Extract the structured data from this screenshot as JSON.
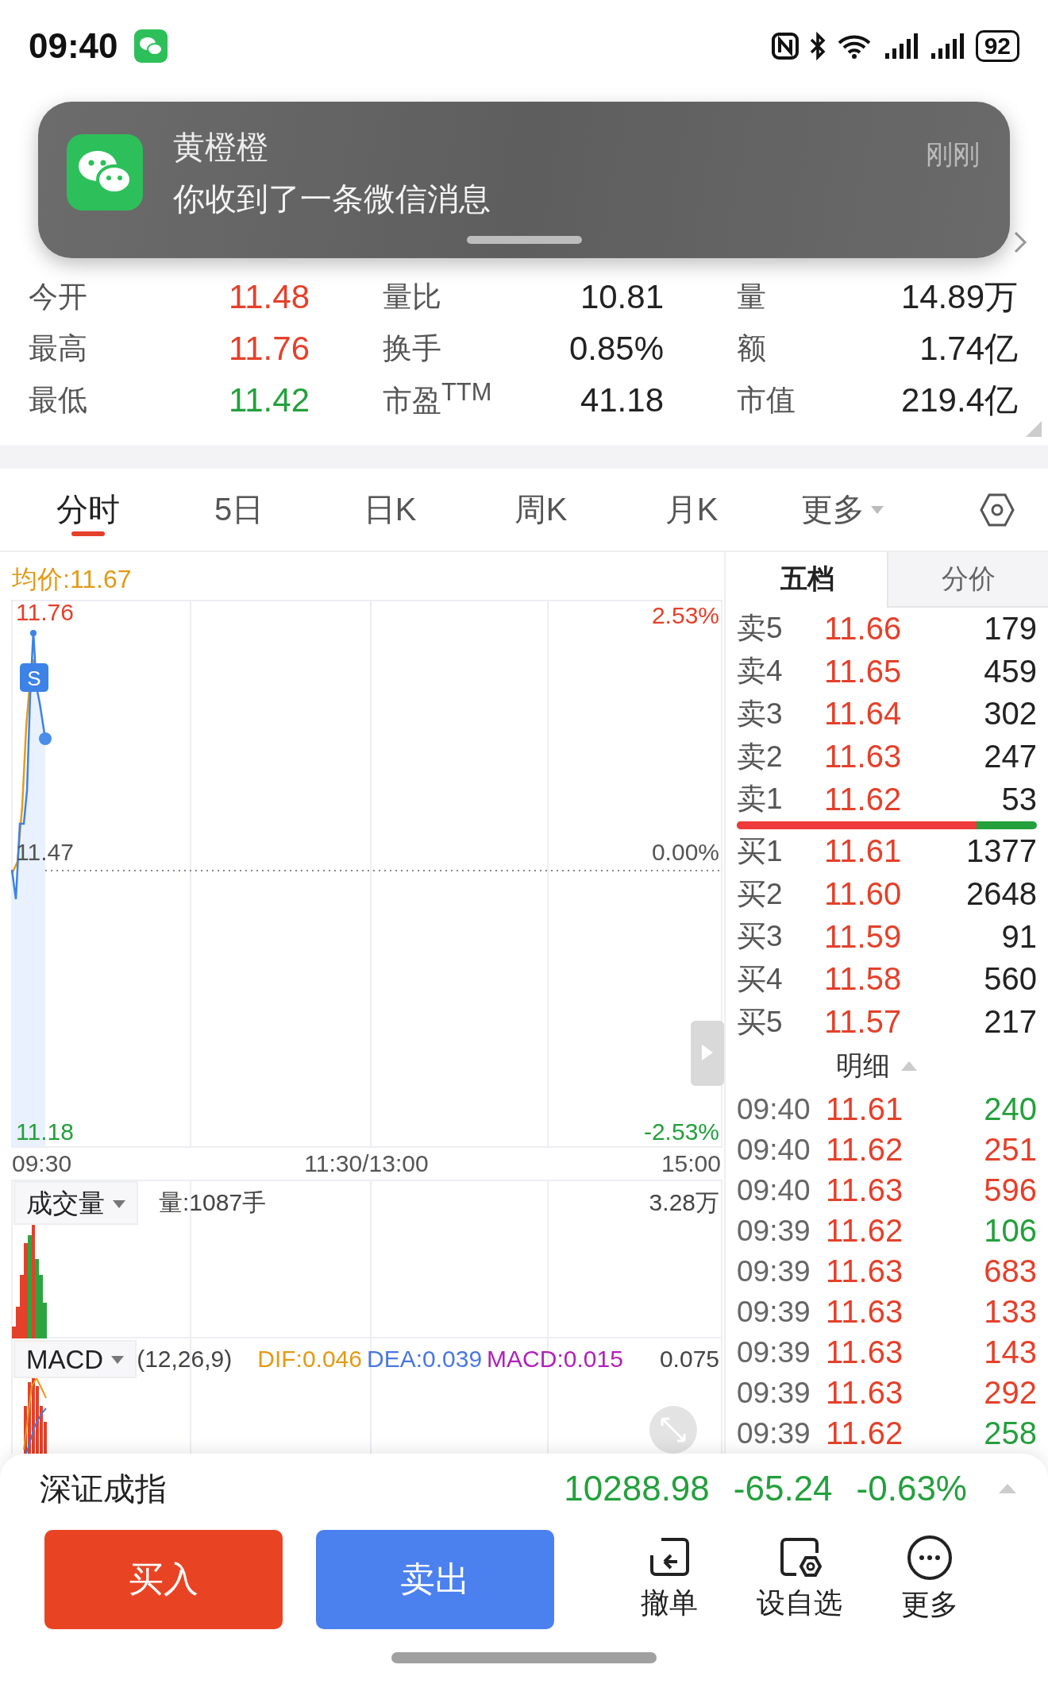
{
  "status_bar": {
    "time": "09:40",
    "battery": "92"
  },
  "notification": {
    "title": "黄橙橙",
    "message": "你收到了一条微信消息",
    "time": "刚刚"
  },
  "quote_stats": [
    {
      "label": "今开",
      "value": "11.48",
      "color": "#e5402a"
    },
    {
      "label": "量比",
      "value": "10.81",
      "color": "#222222"
    },
    {
      "label": "量",
      "value": "14.89万",
      "color": "#222222"
    },
    {
      "label": "最高",
      "value": "11.76",
      "color": "#e5402a"
    },
    {
      "label": "换手",
      "value": "0.85%",
      "color": "#222222"
    },
    {
      "label": "额",
      "value": "1.74亿",
      "color": "#222222"
    },
    {
      "label": "最低",
      "value": "11.42",
      "color": "#23a03c"
    },
    {
      "label": "市盈$^{TTM}$",
      "value": "41.18",
      "color": "#222222"
    },
    {
      "label": "市值",
      "value": "219.4亿",
      "color": "#222222"
    }
  ],
  "tabs": [
    {
      "label": "分时",
      "selected": true,
      "kind": "plain"
    },
    {
      "label": "5日",
      "selected": false,
      "kind": "plain"
    },
    {
      "label": "日K",
      "selected": false,
      "kind": "plain"
    },
    {
      "label": "周K",
      "selected": false,
      "kind": "plain"
    },
    {
      "label": "月K",
      "selected": false,
      "kind": "plain"
    },
    {
      "label": "更多",
      "selected": false,
      "kind": "dropdown"
    }
  ],
  "chart": {
    "avg_price": "均价:11.67",
    "marker": "S",
    "high": "11.76",
    "high_pct": "2.53%",
    "mid": "11.47",
    "mid_pct": "0.00%",
    "low": "11.18",
    "low_pct": "-2.53%",
    "time_axis": [
      "09:30",
      "11:30/13:00",
      "15:00"
    ],
    "volume": {
      "selector": "成交量",
      "reading": "量:1087手",
      "max": "3.28万"
    },
    "macd": {
      "selector": "MACD",
      "params": "(12,26,9)",
      "dif": "DIF:0.046",
      "dea": "DEA:0.039",
      "macd": "MACD:0.015",
      "max": "0.075"
    }
  },
  "order_book": {
    "tabs": [
      {
        "label": "五档",
        "selected": true
      },
      {
        "label": "分价",
        "selected": false
      }
    ],
    "asks": [
      {
        "label": "卖5",
        "price": "11.66",
        "volume": "179"
      },
      {
        "label": "卖4",
        "price": "11.65",
        "volume": "459"
      },
      {
        "label": "卖3",
        "price": "11.64",
        "volume": "302"
      },
      {
        "label": "卖2",
        "price": "11.63",
        "volume": "247"
      },
      {
        "label": "卖1",
        "price": "11.62",
        "volume": "53"
      }
    ],
    "bid_share": {
      "level": 0.8
    },
    "bids": [
      {
        "label": "买1",
        "price": "11.61",
        "volume": "1377"
      },
      {
        "label": "买2",
        "price": "11.60",
        "volume": "2648"
      },
      {
        "label": "买3",
        "price": "11.59",
        "volume": "91"
      },
      {
        "label": "买4",
        "price": "11.58",
        "volume": "560"
      },
      {
        "label": "买5",
        "price": "11.57",
        "volume": "217"
      }
    ],
    "details_label": "明细",
    "trades": [
      {
        "time": "09:40",
        "price": "11.61",
        "volume": "240",
        "color": "#23a03c"
      },
      {
        "time": "09:40",
        "price": "11.62",
        "volume": "251",
        "color": "#e5402a"
      },
      {
        "time": "09:40",
        "price": "11.63",
        "volume": "596",
        "color": "#e5402a"
      },
      {
        "time": "09:39",
        "price": "11.62",
        "volume": "106",
        "color": "#23a03c"
      },
      {
        "time": "09:39",
        "price": "11.63",
        "volume": "683",
        "color": "#e5402a"
      },
      {
        "time": "09:39",
        "price": "11.63",
        "volume": "133",
        "color": "#e5402a"
      },
      {
        "time": "09:39",
        "price": "11.63",
        "volume": "143",
        "color": "#e5402a"
      },
      {
        "time": "09:39",
        "price": "11.63",
        "volume": "292",
        "color": "#e5402a"
      },
      {
        "time": "09:39",
        "price": "11.62",
        "volume": "258",
        "color": "#23a03c"
      }
    ]
  },
  "index_bar": {
    "name": "深证成指",
    "value": "10288.98",
    "change": "-65.24",
    "pct": "-0.63%",
    "color": "#23a03c"
  },
  "buy_button": "买入",
  "sell_button": "卖出",
  "actions": [
    {
      "label": "撤单",
      "kind": "cancel"
    },
    {
      "label": "设自选",
      "kind": "watch"
    },
    {
      "label": "更多",
      "kind": "more"
    }
  ]
}
